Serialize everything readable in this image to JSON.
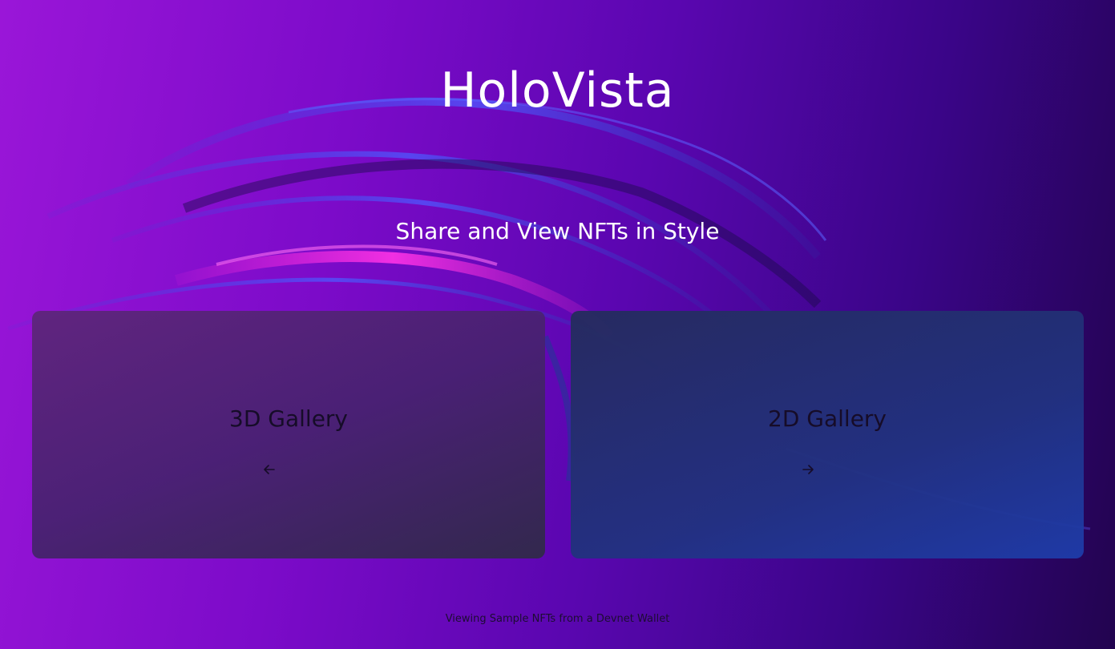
{
  "header": {
    "title": "HoloVista",
    "subtitle": "Share and View NFTs in Style"
  },
  "cards": [
    {
      "label": "3D Gallery",
      "icon": "arrow-left-icon"
    },
    {
      "label": "2D Gallery",
      "icon": "arrow-right-icon"
    }
  ],
  "footer": {
    "text": "Viewing Sample NFTs from a Devnet Wallet"
  },
  "colors": {
    "background_start": "#9a16d8",
    "background_end": "#22044f",
    "title_text": "#ffffff",
    "card_text": "#160c28"
  }
}
